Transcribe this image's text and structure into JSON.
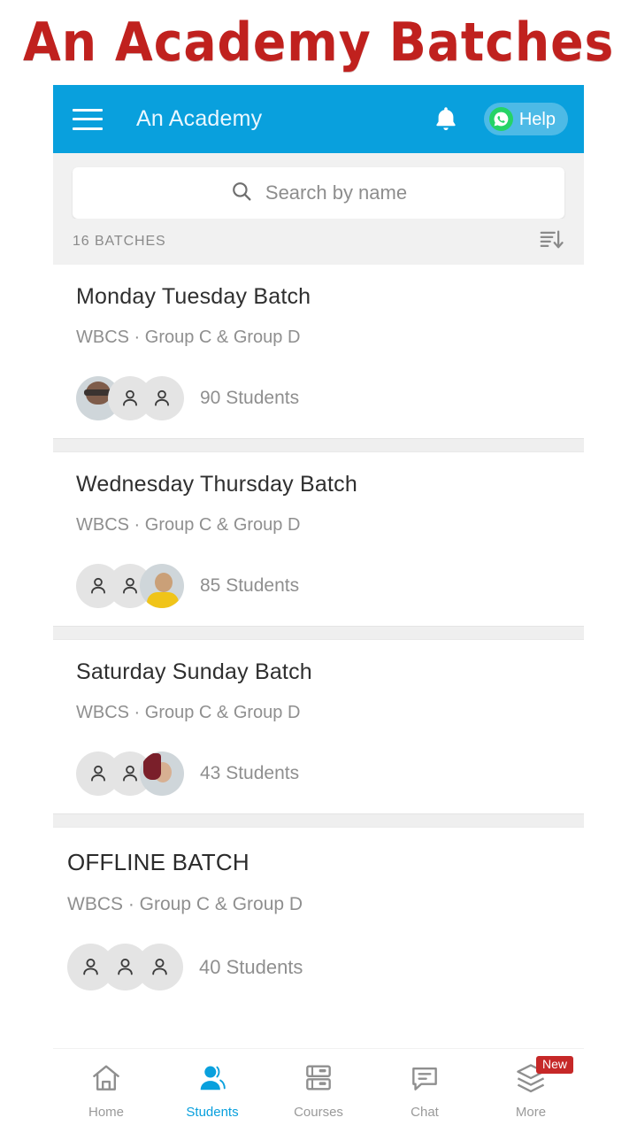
{
  "banner": {
    "title": "An Academy Batches",
    "color": "#C0211E"
  },
  "appbar": {
    "title": "An Academy",
    "menu_icon": "hamburger-menu-icon",
    "bell_icon": "notification-bell-icon",
    "help_label": "Help",
    "help_icon": "whatsapp-icon",
    "background": "#09A0DD"
  },
  "search": {
    "placeholder": "Search by name",
    "value": "",
    "icon": "search-icon"
  },
  "list_header": {
    "count_label": "16 BATCHES",
    "sort_icon": "sort-descending-icon"
  },
  "batches": [
    {
      "title": "Monday Tuesday Batch",
      "subtitle": "WBCS · Group C & Group D",
      "students": "90 Students",
      "avatars": [
        "photo-man-red-shirt",
        "person-placeholder",
        "person-placeholder"
      ]
    },
    {
      "title": "Wednesday Thursday Batch",
      "subtitle": "WBCS · Group C & Group D",
      "students": "85 Students",
      "avatars": [
        "person-placeholder",
        "person-placeholder",
        "photo-woman-yellow-top"
      ]
    },
    {
      "title": "Saturday Sunday Batch",
      "subtitle": "WBCS · Group C & Group D",
      "students": "43 Students",
      "avatars": [
        "person-placeholder",
        "person-placeholder",
        "photo-woman-dark-hair"
      ]
    },
    {
      "title": "OFFLINE BATCH",
      "subtitle": "WBCS · Group C & Group D",
      "students": "40 Students",
      "avatars": [
        "person-placeholder",
        "person-placeholder",
        "person-placeholder"
      ]
    }
  ],
  "bottom_nav": {
    "items": [
      {
        "label": "Home",
        "icon": "home-icon",
        "active": false,
        "badge": ""
      },
      {
        "label": "Students",
        "icon": "person-icon",
        "active": true,
        "badge": ""
      },
      {
        "label": "Courses",
        "icon": "books-icon",
        "active": false,
        "badge": ""
      },
      {
        "label": "Chat",
        "icon": "chat-icon",
        "active": false,
        "badge": ""
      },
      {
        "label": "More",
        "icon": "layers-icon",
        "active": false,
        "badge": "New"
      }
    ],
    "active_color": "#09A0DD",
    "badge_color": "#C62828"
  }
}
